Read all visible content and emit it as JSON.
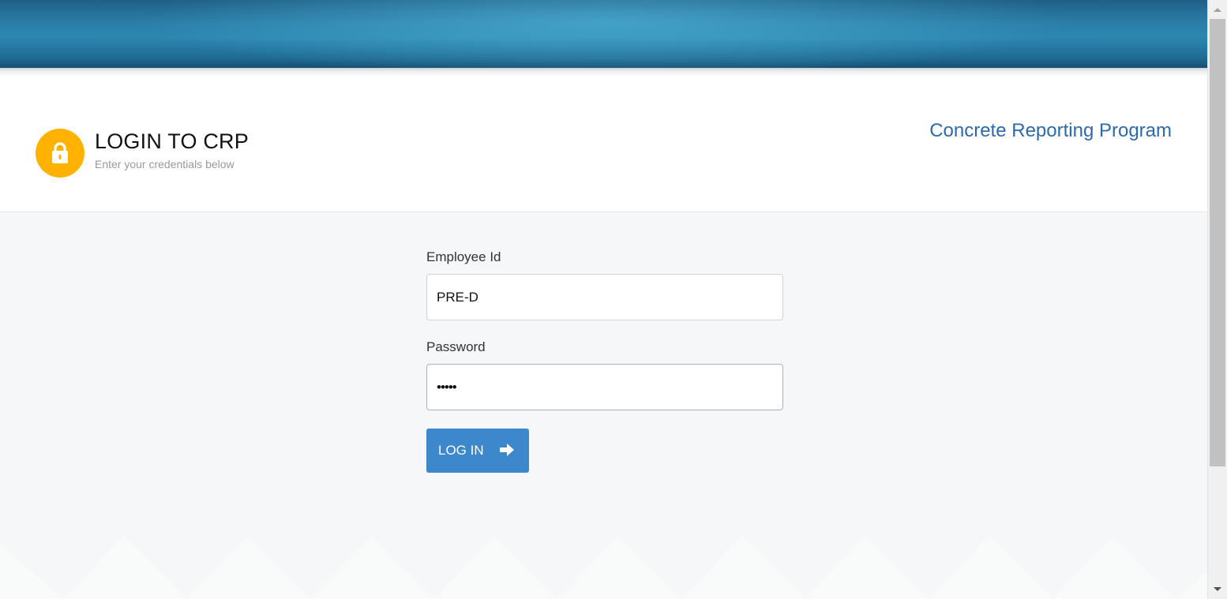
{
  "header": {
    "title": "LOGIN TO CRP",
    "subtitle": "Enter your credentials below",
    "app_name": "Concrete Reporting Program",
    "icon": "lock-icon",
    "icon_color": "#ffb300"
  },
  "form": {
    "employee_id_label": "Employee Id",
    "employee_id_value": "PRE-D",
    "password_label": "Password",
    "password_value": "•••••",
    "login_label": "LOG IN",
    "login_icon": "arrow-right-icon"
  },
  "colors": {
    "banner": "#2a7fa9",
    "button": "#3d87cc",
    "link": "#2c6aad",
    "background": "#f6f7f8"
  }
}
